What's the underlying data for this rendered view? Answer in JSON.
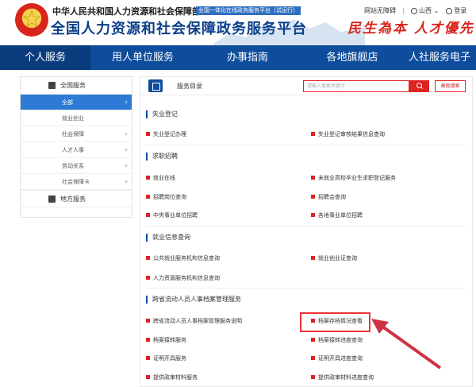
{
  "header": {
    "ministry": "中华人民共和国人力资源和社会保障部",
    "trial_tag": "全国一体化在线政务服务平台（试运行）",
    "platform": "全国人力资源和社会保障政务服务平台",
    "slogan": "民生為本 人才優先",
    "accessibility": "网站无障碍",
    "region": "山西",
    "login": "登录"
  },
  "nav": {
    "items": [
      "个人服务",
      "用人单位服务",
      "办事指南",
      "各地旗舰店",
      "人社服务电子"
    ]
  },
  "sidebar": {
    "national": "全国服务",
    "items": [
      "全部",
      "就业创业",
      "社会保障",
      "人才人事",
      "劳动关系",
      "社会保障卡"
    ],
    "local": "地方服务"
  },
  "panel": {
    "title": "服务目录",
    "search_placeholder": "请输入搜索关键字",
    "advanced": "高级搜索",
    "sections": [
      {
        "title": "失业登记",
        "items": [
          "失业登记办理",
          "失业登记审核结果信息查询"
        ]
      },
      {
        "title": "求职招聘",
        "items": [
          "就业在线",
          "未就业高校毕业生求职登记服务",
          "招聘岗位查询",
          "招聘会查询",
          "中央事业单位招聘",
          "各地事业单位招聘"
        ]
      },
      {
        "title": "就业信息查询",
        "items": [
          "公共就业服务机构信息查询",
          "就业创业证查询",
          "人力资源服务机构信息查询"
        ]
      },
      {
        "title": "跨省流动人员人事档案管理服务",
        "items": [
          "跨省流动人员人事档案管理服务说明",
          "档案存档情况查看",
          "档案接转服务",
          "档案接转进度查询",
          "证明开具服务",
          "证明开具进度查询",
          "提供政审材料服务",
          "提供政审材料进度查询"
        ]
      }
    ]
  },
  "colors": {
    "brand": "#0e4d9c",
    "accent": "#dd2222",
    "sidebar_active": "#2d7bd4"
  }
}
